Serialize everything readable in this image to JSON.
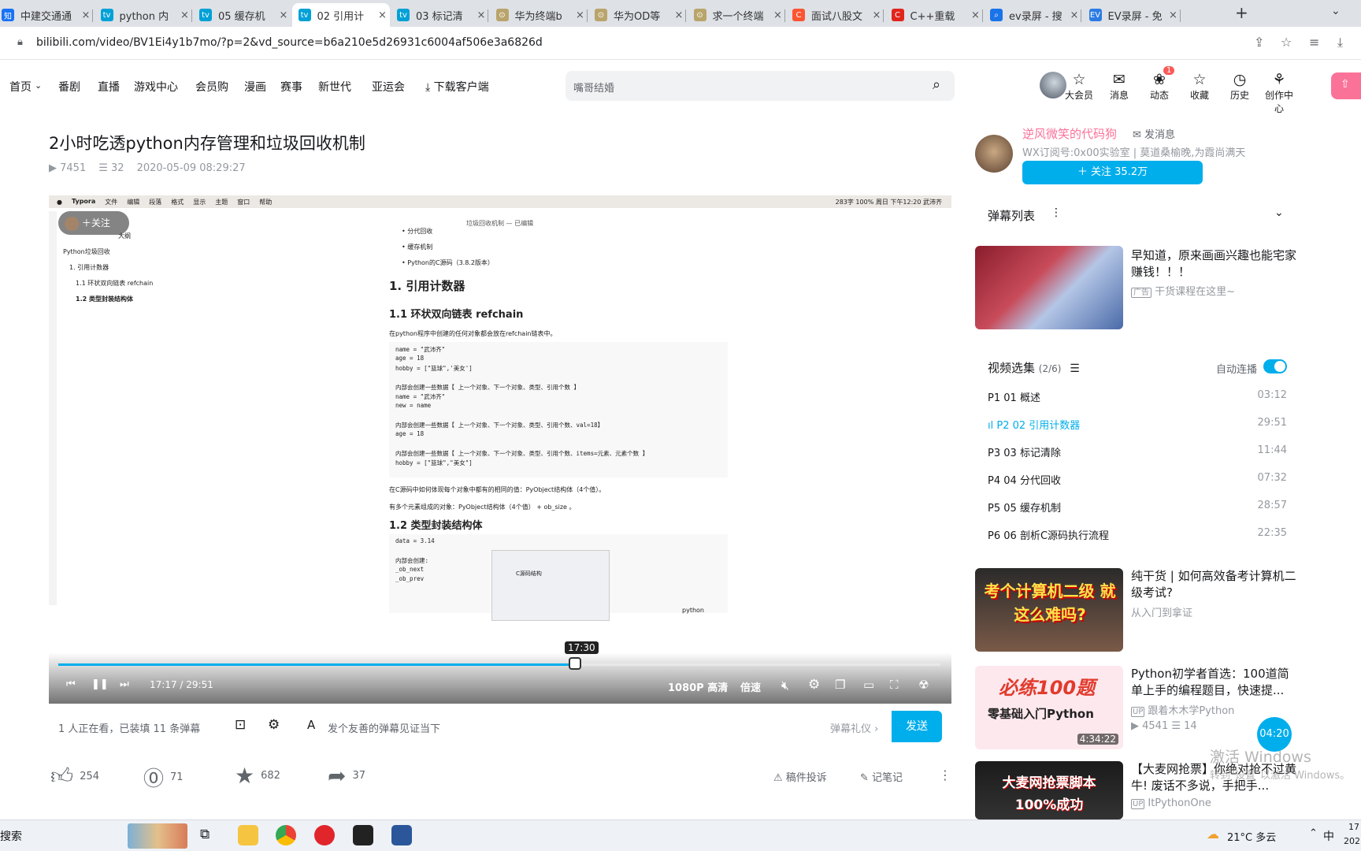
{
  "browser": {
    "tabs": [
      {
        "title": "中建交通通",
        "fav": "知",
        "color": "#1772f6"
      },
      {
        "title": "python 内",
        "fav": "tv",
        "color": "#00a1d6"
      },
      {
        "title": "05 缓存机",
        "fav": "tv",
        "color": "#00a1d6"
      },
      {
        "title": "02 引用计",
        "fav": "tv",
        "color": "#00a1d6"
      },
      {
        "title": "03 标记清",
        "fav": "tv",
        "color": "#00a1d6"
      },
      {
        "title": "华为终端b",
        "fav": "⊙",
        "color": "#b9a46b"
      },
      {
        "title": "华为OD等",
        "fav": "⊙",
        "color": "#b9a46b"
      },
      {
        "title": "求一个终端",
        "fav": "⊙",
        "color": "#b9a46b"
      },
      {
        "title": "面试八股文",
        "fav": "C",
        "color": "#fc5531"
      },
      {
        "title": "C++重载",
        "fav": "C",
        "color": "#e1251b"
      },
      {
        "title": "ev录屏 - 搜",
        "fav": "⌕",
        "color": "#1a73e8"
      },
      {
        "title": "EV录屏 - 免",
        "fav": "EV",
        "color": "#2c7be5"
      }
    ],
    "new_tab": "+",
    "url": "bilibili.com/video/BV1Ei4y1b7mo/?p=2&vd_source=b6a210e5d26931c6004af506e3a6826d"
  },
  "nav": {
    "items": [
      "首页",
      "番剧",
      "直播",
      "游戏中心",
      "会员购",
      "漫画",
      "赛事",
      "新世代",
      "亚运会"
    ],
    "download": "下载客户端",
    "search_placeholder": "嘴哥结婚",
    "icons": [
      {
        "label": "大会员",
        "icon": "vip-icon",
        "glyph": "☆"
      },
      {
        "label": "消息",
        "icon": "message-icon",
        "glyph": "✉"
      },
      {
        "label": "动态",
        "icon": "dynamic-icon",
        "glyph": "❀",
        "badge": "1"
      },
      {
        "label": "收藏",
        "icon": "star-icon",
        "glyph": "☆"
      },
      {
        "label": "历史",
        "icon": "history-icon",
        "glyph": "◷"
      },
      {
        "label": "创作中心",
        "icon": "bulb-icon",
        "glyph": "⚘"
      }
    ]
  },
  "video": {
    "title": "2小时吃透python内存管理和垃圾回收机制",
    "views": "7451",
    "danmaku": "32",
    "date": "2020-05-09 08:29:27",
    "follow_overlay": "关注",
    "tooltip_time": "17:30",
    "time": "17:17 / 29:51",
    "progress": 0.579,
    "quality": "1080P 高清",
    "speed": "倍速",
    "macbar": [
      "Typora",
      "文件",
      "编辑",
      "段落",
      "格式",
      "显示",
      "主题",
      "窗口",
      "帮助"
    ],
    "mac_right": "283字  100%  周日 下午12:20  武沛齐",
    "doc_window_title": "垃圾回收机制 — 已编辑",
    "outline": [
      "大纲",
      "Python垃圾回收",
      "1. 引用计数器",
      "1.1 环状双向链表 refchain",
      "1.2 类型封装结构体"
    ],
    "bullets": [
      "分代回收",
      "缓存机制",
      "Python的C源码（3.8.2版本）"
    ],
    "h1": "1. 引用计数器",
    "h2a": "1.1 环状双向链表 refchain",
    "p1": "在python程序中创建的任何对象都会放在refchain链表中。",
    "code1": [
      "name = \"武沛齐\"",
      "age = 18",
      "hobby = [\"篮球\",'美女']",
      "",
      "内部会创建一些数据【 上一个对象、下一个对象、类型、引用个数 】",
      "name = \"武沛齐\"",
      "new = name",
      "",
      "内部会创建一些数据【 上一个对象、下一个对象、类型、引用个数、val=18】",
      "age = 18",
      "",
      "内部会创建一些数据【 上一个对象、下一个对象、类型、引用个数、items=元素、元素个数 】",
      "hobby = [\"篮球\",\"美女\"]"
    ],
    "p2": "在C源码中如何体现每个对象中都有的相同的值：PyObject结构体（4个值）。",
    "p3": "有多个元素组成的对象：PyObject结构体（4个值） + ob_size 。",
    "h2b": "1.2 类型封装结构体",
    "code2": [
      "data = 3.14",
      "",
      "内部会创建:",
      "    _ob_next",
      "    _ob_prev"
    ],
    "embedded_label": "C源码结构",
    "python_label": "python"
  },
  "below_video": {
    "watching": "1 人正在看，已装填 11 条弹幕",
    "danmaku_hint": "发个友善的弹幕见证当下",
    "etiquette": "弹幕礼仪 ›",
    "send": "发送",
    "like": "254",
    "coin": "71",
    "fav": "682",
    "share": "37",
    "report": "稿件投诉",
    "note": "记笔记"
  },
  "uploader": {
    "name": "逆风微笑的代码狗",
    "message": "发消息",
    "desc": "WX订阅号:0x00实验室 | 莫道桑榆晚,为霞尚满天",
    "follow": "关注 35.2万"
  },
  "danmaku_list": {
    "title": "弹幕列表"
  },
  "ad": {
    "title": "早知道，原来画画兴趣也能宅家赚钱！！！",
    "tag": "广告",
    "sub": "干货课程在这里~"
  },
  "playlist": {
    "title": "视频选集",
    "count": "(2/6)",
    "autoplay": "自动连播",
    "episodes": [
      {
        "idx": "P1",
        "name": "01 概述",
        "dur": "03:12"
      },
      {
        "idx": "P2",
        "name": "02 引用计数器",
        "dur": "29:51"
      },
      {
        "idx": "P3",
        "name": "03 标记清除",
        "dur": "11:44"
      },
      {
        "idx": "P4",
        "name": "04 分代回收",
        "dur": "07:32"
      },
      {
        "idx": "P5",
        "name": "05 缓存机制",
        "dur": "28:57"
      },
      {
        "idx": "P6",
        "name": "06 剖析C源码执行流程",
        "dur": "22:35"
      }
    ]
  },
  "recommend": [
    {
      "title": "纯干货 | 如何高效备考计算机二级考试?",
      "author": "从入门到拿证",
      "thumb_text": "考个计算机二级 就这么难吗?"
    },
    {
      "title": "Python初学者首选：100道简单上手的编程题目，快速提...",
      "author": "跟着木木学Python",
      "views": "4541",
      "dm": "14",
      "duration": "4:34:22",
      "thumb_text1": "必练100题",
      "thumb_text2": "零基础入门Python"
    },
    {
      "title": "【大麦网抢票】你绝对抢不过黄牛! 废话不多说，手把手...",
      "author": "ItPythonOne",
      "thumb_text": "大麦网抢票脚本 100%成功"
    }
  ],
  "float_timer": "04:20",
  "watermark": {
    "line1": "激活 Windows",
    "line2": "转到\"设置\"以激活 Windows。"
  },
  "taskbar": {
    "search": "搜索",
    "weather": "21°C  多云",
    "lang": "中",
    "time": "17",
    "date": "202"
  },
  "colors": {
    "accent": "#00aeec",
    "pink": "#fb7299",
    "link": "#00aeec"
  }
}
